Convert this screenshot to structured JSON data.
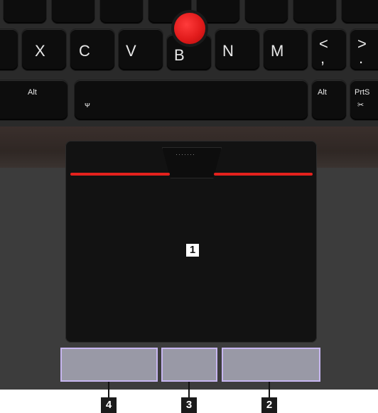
{
  "keyboard": {
    "keys": {
      "x": "X",
      "c": "C",
      "v": "V",
      "b": "B",
      "n": "N",
      "m": "M",
      "comma_top": "<",
      "comma_bottom": ",",
      "period_top": ">",
      "period_bottom": ".",
      "alt_left": "Alt",
      "alt_right": "Alt",
      "prtsc": "PrtS",
      "space_icon": "ᴪ"
    },
    "trackpoint_color": "#e11b1b"
  },
  "touchpad": {
    "stripe_color": "#e4211d",
    "dots": "·······",
    "callout_1": "1"
  },
  "zones": {
    "color": "#9999a6",
    "border_color": "#c7b6f0"
  },
  "callouts": {
    "left_click": "4",
    "middle_click": "3",
    "right_click": "2"
  }
}
